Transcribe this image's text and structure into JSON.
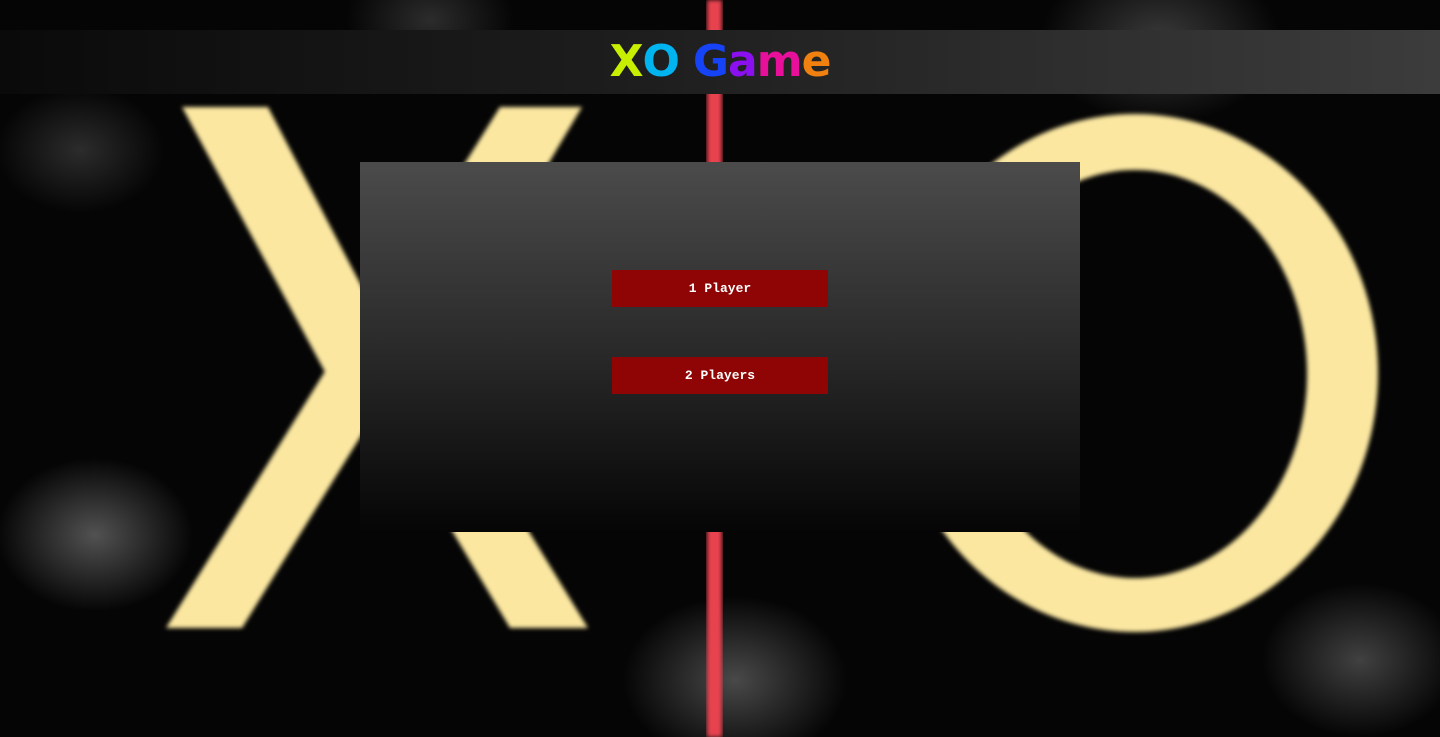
{
  "header": {
    "title_letters": [
      {
        "char": "X",
        "color": "#c9ef00"
      },
      {
        "char": "O",
        "color": "#00b4f0"
      },
      {
        "char": " ",
        "color": "#ffffff"
      },
      {
        "char": "G",
        "color": "#1543f5"
      },
      {
        "char": "a",
        "color": "#8a10ef"
      },
      {
        "char": "m",
        "color": "#e8109a"
      },
      {
        "char": "e",
        "color": "#f08010"
      }
    ]
  },
  "menu": {
    "one_player_label": "1 Player",
    "two_players_label": "2 Players"
  },
  "colors": {
    "button_bg": "#8f0505",
    "divider_line": "#e8434f",
    "background_glyph": "#fbe7a0"
  }
}
